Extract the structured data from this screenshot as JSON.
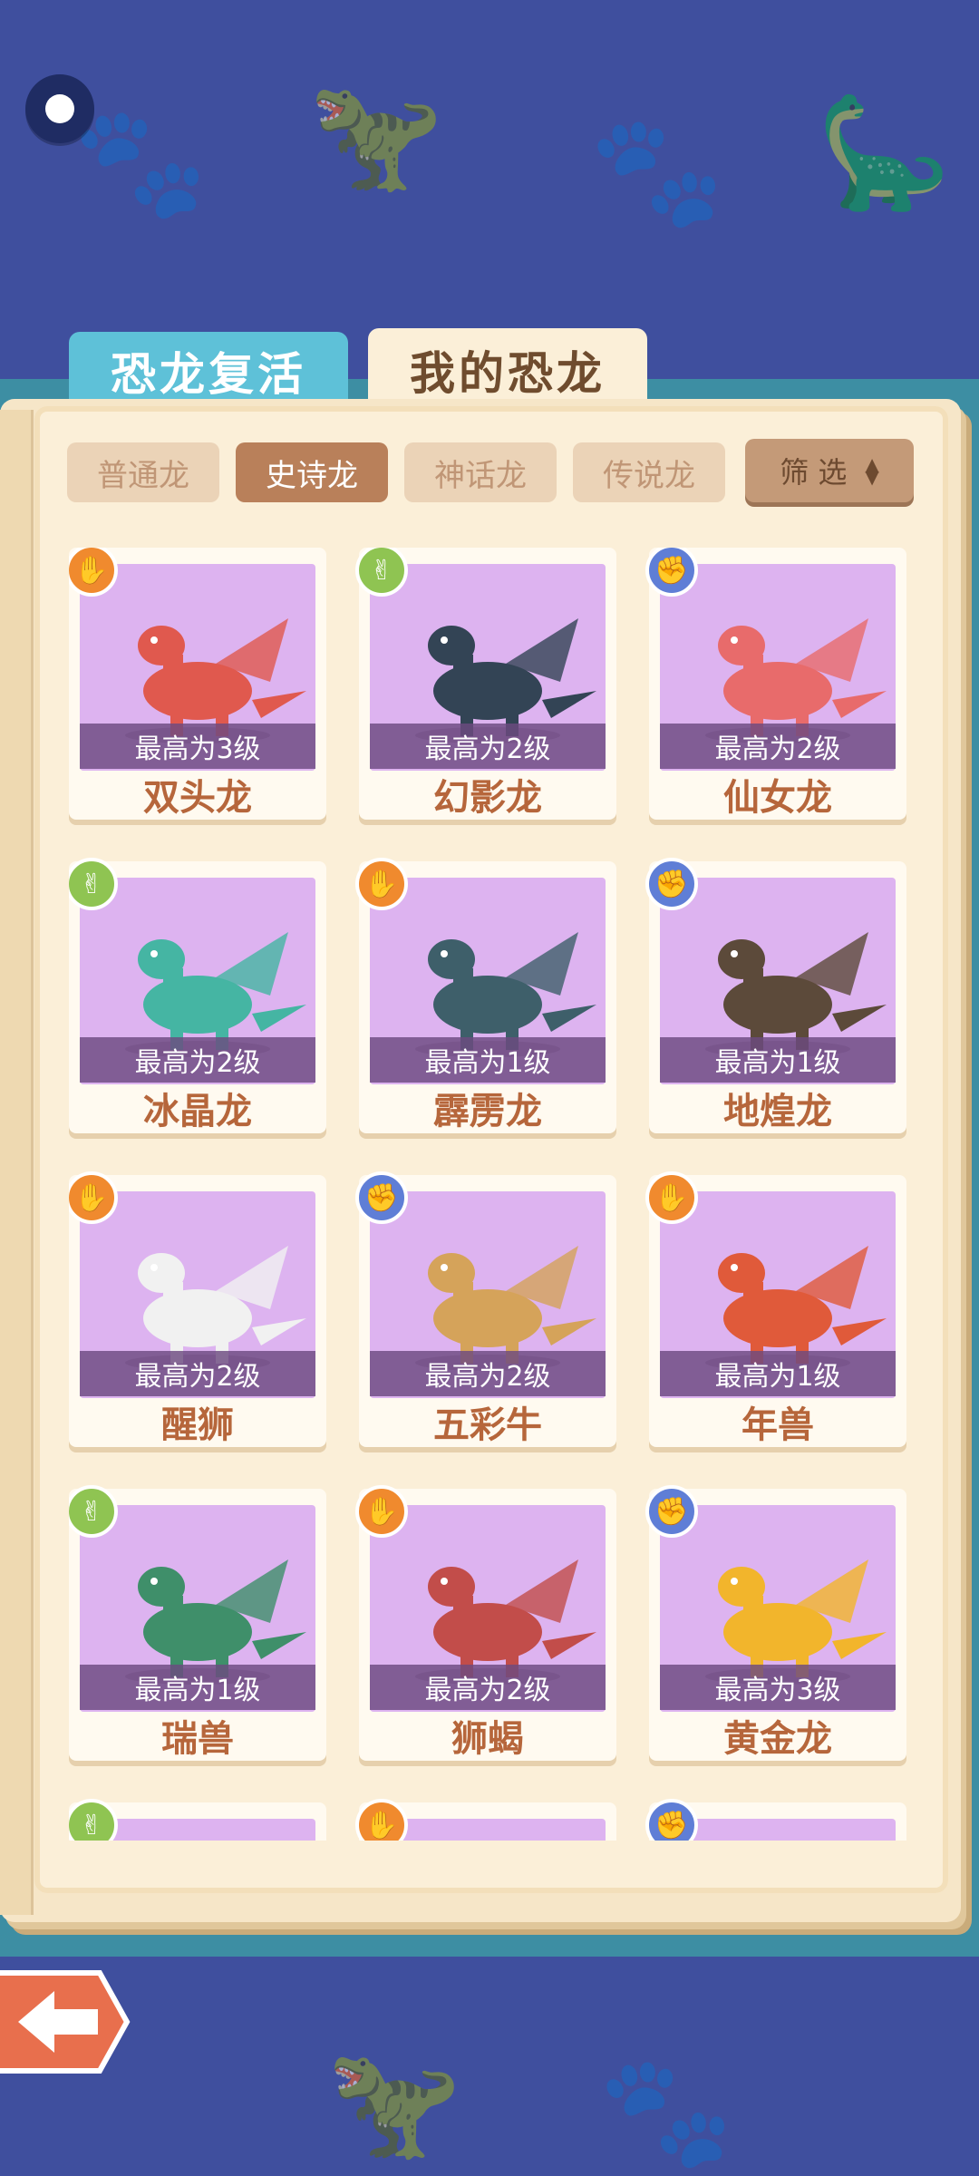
{
  "tabs": {
    "revive": "恐龙复活",
    "mine": "我的恐龙"
  },
  "categories": [
    "普通龙",
    "史诗龙",
    "神话龙",
    "传说龙"
  ],
  "active_category": "史诗龙",
  "filter": {
    "label": "筛 选"
  },
  "colors": {
    "background": "#3f4f9e",
    "book": "#fbefd8",
    "card_image_bg": "#ddb3f0",
    "name_text": "#b6663b",
    "active_category": "#b9805a"
  },
  "dragons": [
    {
      "name": "双头龙",
      "level": "最高为3级",
      "hand": "paper"
    },
    {
      "name": "幻影龙",
      "level": "最高为2级",
      "hand": "scissors"
    },
    {
      "name": "仙女龙",
      "level": "最高为2级",
      "hand": "rock"
    },
    {
      "name": "冰晶龙",
      "level": "最高为2级",
      "hand": "scissors"
    },
    {
      "name": "霹雳龙",
      "level": "最高为1级",
      "hand": "paper"
    },
    {
      "name": "地煌龙",
      "level": "最高为1级",
      "hand": "rock"
    },
    {
      "name": "醒狮",
      "level": "最高为2级",
      "hand": "paper"
    },
    {
      "name": "五彩牛",
      "level": "最高为2级",
      "hand": "rock"
    },
    {
      "name": "年兽",
      "level": "最高为1级",
      "hand": "paper"
    },
    {
      "name": "瑞兽",
      "level": "最高为1级",
      "hand": "scissors"
    },
    {
      "name": "狮蝎",
      "level": "最高为2级",
      "hand": "paper"
    },
    {
      "name": "黄金龙",
      "level": "最高为3级",
      "hand": "rock"
    },
    {
      "name": "",
      "level": "",
      "hand": "scissors"
    },
    {
      "name": "",
      "level": "",
      "hand": "paper"
    },
    {
      "name": "",
      "level": "",
      "hand": "rock"
    }
  ],
  "icons": {
    "settings": "settings-dot-icon",
    "back": "back-arrow-icon",
    "filter_sort": "sort-arrows-icon"
  }
}
